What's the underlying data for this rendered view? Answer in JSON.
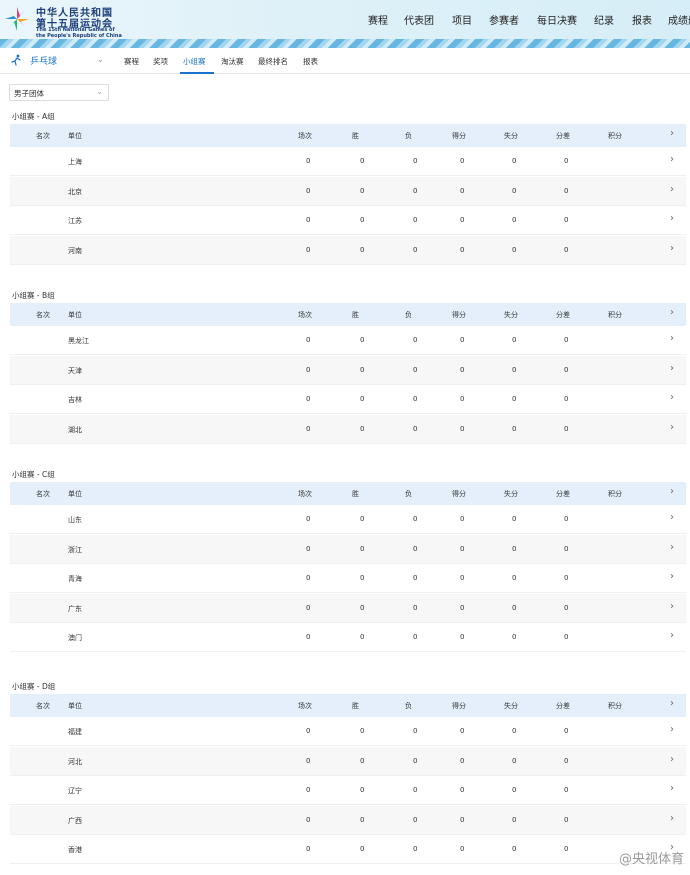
{
  "header": {
    "logo_cn_line1": "中华人民共和国",
    "logo_cn_line2": "第十五届运动会",
    "logo_en_line1": "The 15th National Games of",
    "logo_en_line2": "the People's Republic of China",
    "nav": [
      "赛程",
      "代表团",
      "项目",
      "参赛者",
      "每日决赛",
      "纪录",
      "报表",
      "成绩册"
    ]
  },
  "subbar": {
    "sport": "乒乓球",
    "sport_icon": "table-tennis-icon",
    "tabs": [
      "赛程",
      "奖项",
      "小组赛",
      "淘汰赛",
      "最终排名",
      "报表"
    ],
    "active_tab": 2
  },
  "filter": {
    "value": "男子团体"
  },
  "columns": [
    "名次",
    "单位",
    "场次",
    "胜",
    "负",
    "得分",
    "失分",
    "分差",
    "积分"
  ],
  "groups": [
    {
      "title": "小组赛 - A组",
      "rows": [
        {
          "team": "上海",
          "played": "0",
          "won": "0",
          "lost": "0",
          "gf": "0",
          "ga": "0",
          "diff": "0"
        },
        {
          "team": "北京",
          "played": "0",
          "won": "0",
          "lost": "0",
          "gf": "0",
          "ga": "0",
          "diff": "0"
        },
        {
          "team": "江苏",
          "played": "0",
          "won": "0",
          "lost": "0",
          "gf": "0",
          "ga": "0",
          "diff": "0"
        },
        {
          "team": "河南",
          "played": "0",
          "won": "0",
          "lost": "0",
          "gf": "0",
          "ga": "0",
          "diff": "0"
        }
      ]
    },
    {
      "title": "小组赛 - B组",
      "rows": [
        {
          "team": "黑龙江",
          "played": "0",
          "won": "0",
          "lost": "0",
          "gf": "0",
          "ga": "0",
          "diff": "0"
        },
        {
          "team": "天津",
          "played": "0",
          "won": "0",
          "lost": "0",
          "gf": "0",
          "ga": "0",
          "diff": "0"
        },
        {
          "team": "吉林",
          "played": "0",
          "won": "0",
          "lost": "0",
          "gf": "0",
          "ga": "0",
          "diff": "0"
        },
        {
          "team": "湖北",
          "played": "0",
          "won": "0",
          "lost": "0",
          "gf": "0",
          "ga": "0",
          "diff": "0"
        }
      ]
    },
    {
      "title": "小组赛 - C组",
      "rows": [
        {
          "team": "山东",
          "played": "0",
          "won": "0",
          "lost": "0",
          "gf": "0",
          "ga": "0",
          "diff": "0"
        },
        {
          "team": "浙江",
          "played": "0",
          "won": "0",
          "lost": "0",
          "gf": "0",
          "ga": "0",
          "diff": "0"
        },
        {
          "team": "青海",
          "played": "0",
          "won": "0",
          "lost": "0",
          "gf": "0",
          "ga": "0",
          "diff": "0"
        },
        {
          "team": "广东",
          "played": "0",
          "won": "0",
          "lost": "0",
          "gf": "0",
          "ga": "0",
          "diff": "0"
        },
        {
          "team": "澳门",
          "played": "0",
          "won": "0",
          "lost": "0",
          "gf": "0",
          "ga": "0",
          "diff": "0"
        }
      ]
    },
    {
      "title": "小组赛 - D组",
      "rows": [
        {
          "team": "福建",
          "played": "0",
          "won": "0",
          "lost": "0",
          "gf": "0",
          "ga": "0",
          "diff": "0"
        },
        {
          "team": "河北",
          "played": "0",
          "won": "0",
          "lost": "0",
          "gf": "0",
          "ga": "0",
          "diff": "0"
        },
        {
          "team": "辽宁",
          "played": "0",
          "won": "0",
          "lost": "0",
          "gf": "0",
          "ga": "0",
          "diff": "0"
        },
        {
          "team": "广西",
          "played": "0",
          "won": "0",
          "lost": "0",
          "gf": "0",
          "ga": "0",
          "diff": "0"
        },
        {
          "team": "香港",
          "played": "0",
          "won": "0",
          "lost": "0",
          "gf": "0",
          "ga": "0",
          "diff": "0"
        }
      ]
    }
  ],
  "watermark": "@央视体育",
  "colors": {
    "accent": "#1a73c8",
    "table_header": "#e4effb",
    "row_alt": "#f7f7f7"
  }
}
